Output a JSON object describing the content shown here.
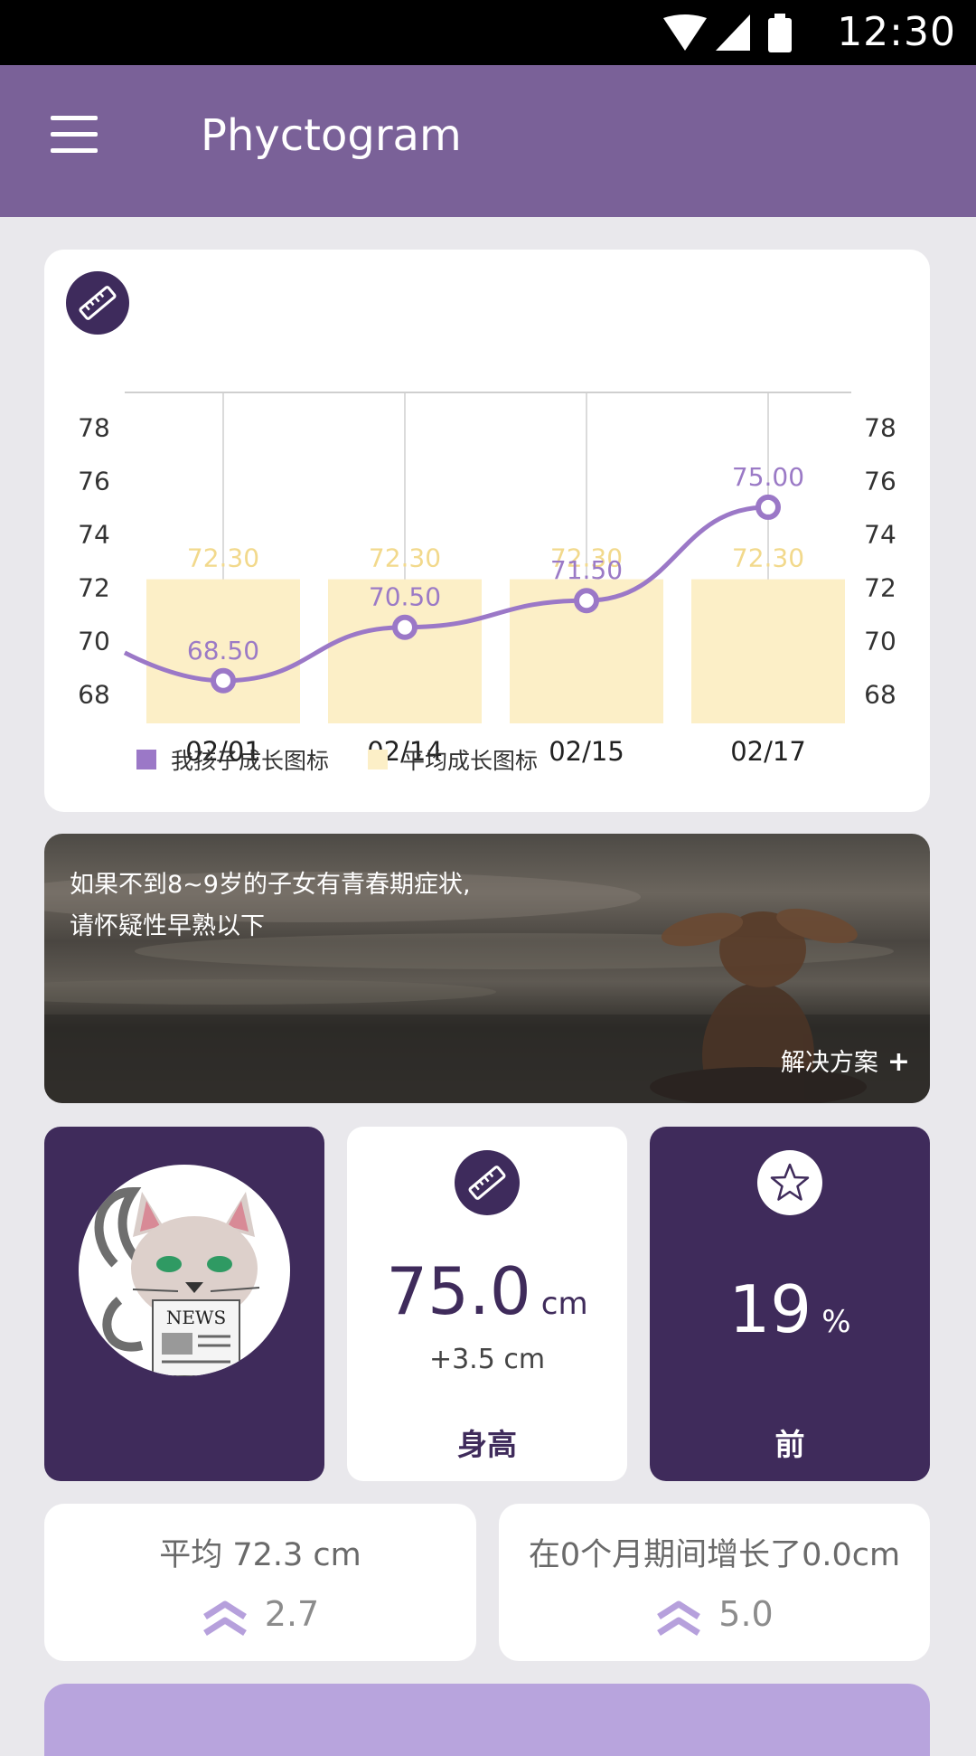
{
  "status_bar": {
    "time": "12:30"
  },
  "app_bar": {
    "title": "Phyctogram"
  },
  "chart_data": {
    "type": "bar",
    "categories": [
      "02/01",
      "02/14",
      "02/15",
      "02/17"
    ],
    "series": [
      {
        "name": "我孩子成长图标",
        "type": "line",
        "values": [
          68.5,
          70.5,
          71.5,
          75.0
        ],
        "labels": [
          "68.50",
          "70.50",
          "71.50",
          "75.00"
        ],
        "color": "#9b78c7"
      },
      {
        "name": "平均成长图标",
        "type": "bar",
        "values": [
          72.3,
          72.3,
          72.3,
          72.3
        ],
        "labels": [
          "72.30",
          "72.30",
          "72.30",
          "72.30"
        ],
        "color": "#fcefc7"
      }
    ],
    "y_ticks": [
      "78",
      "76",
      "74",
      "72",
      "70",
      "68"
    ],
    "ylim": [
      66.9,
      79.3
    ],
    "grid": true,
    "legend_position": "bottom-left"
  },
  "banner": {
    "line1": "如果不到8~9岁的子女有青春期症状,",
    "line2": "请怀疑性早熟以下",
    "action": "解决方案"
  },
  "tiles": {
    "height_value": "75.0",
    "height_unit": "cm",
    "height_delta": "+3.5 cm",
    "height_caption": "身高",
    "percent_value": "19",
    "percent_unit": "%",
    "percent_caption": "前",
    "avatar_text": "NEWS"
  },
  "stats": {
    "average_label": "平均 72.3 cm",
    "average_value": "2.7",
    "growth_label": "在0个月期间增长了0.0cm",
    "growth_value": "5.0"
  },
  "colors": {
    "accent": "#7a6198",
    "dark_tile": "#3f2b5b",
    "line": "#9b78c7",
    "bar": "#fcefc7"
  }
}
